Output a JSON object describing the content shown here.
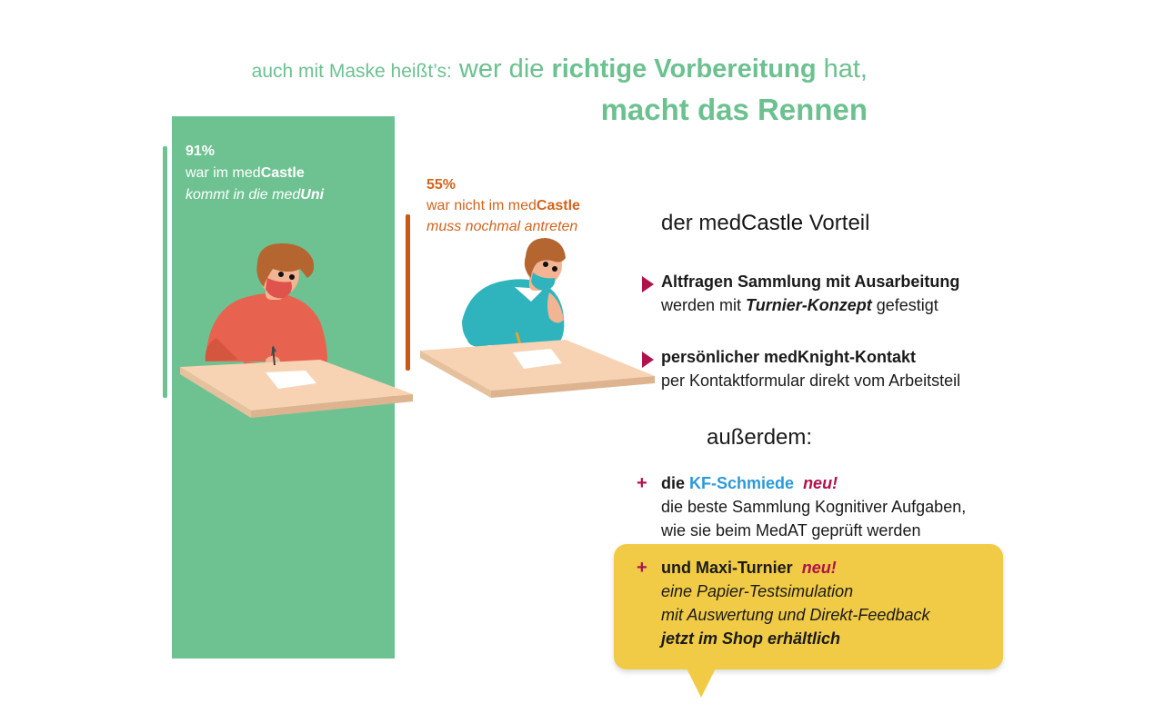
{
  "headline": {
    "part1": "auch mit Maske heißt’s:",
    "part2": " wer die ",
    "part3": "richtige Vorbereitung",
    "part4": " hat,",
    "line2": "macht das Rennen"
  },
  "stat_green": {
    "percent": "91%",
    "line1_prefix": "war im med",
    "line1_bold": "Castle",
    "line2_prefix": "kommt in die med",
    "line2_bold": "Uni"
  },
  "stat_orange": {
    "percent": "55%",
    "line1_prefix": "war nicht im med",
    "line1_bold": "Castle",
    "line2": "muss nochmal antreten"
  },
  "vorteil": {
    "title_prefix": "der med",
    "title_brand": "Castle",
    "title_suffix": " Vorteil",
    "items": [
      {
        "title": "Altfragen Sammlung mit Ausarbeitung",
        "sub_prefix": "werden mit ",
        "sub_bold": "Turnier-Konzept",
        "sub_suffix": " gefestigt"
      },
      {
        "title": "persönlicher medKnight-Kontakt",
        "sub": "per Kontaktformular direkt vom Arbeitsteil"
      }
    ]
  },
  "ausserdem": "außerdem:",
  "extras": {
    "kf": {
      "plus": "+",
      "prefix": "die ",
      "highlight": "KF-Schmiede",
      "badge": "neu!",
      "line2": "die beste Sammlung Kognitiver Aufgaben,",
      "line3": "wie sie beim MedAT geprüft werden"
    },
    "maxi": {
      "plus": "+",
      "prefix": "und ",
      "highlight": "Maxi-Turnier",
      "badge": "neu!",
      "line2": "eine Papier-Testsimulation",
      "line3": "mit Auswertung und Direkt-Feedback",
      "line4": "jetzt im Shop erhältlich"
    }
  },
  "colors": {
    "green": "#6ec292",
    "orange": "#c85a16",
    "crimson": "#b0124c",
    "blue": "#2b9ad8",
    "yellow": "#f1cb45"
  }
}
